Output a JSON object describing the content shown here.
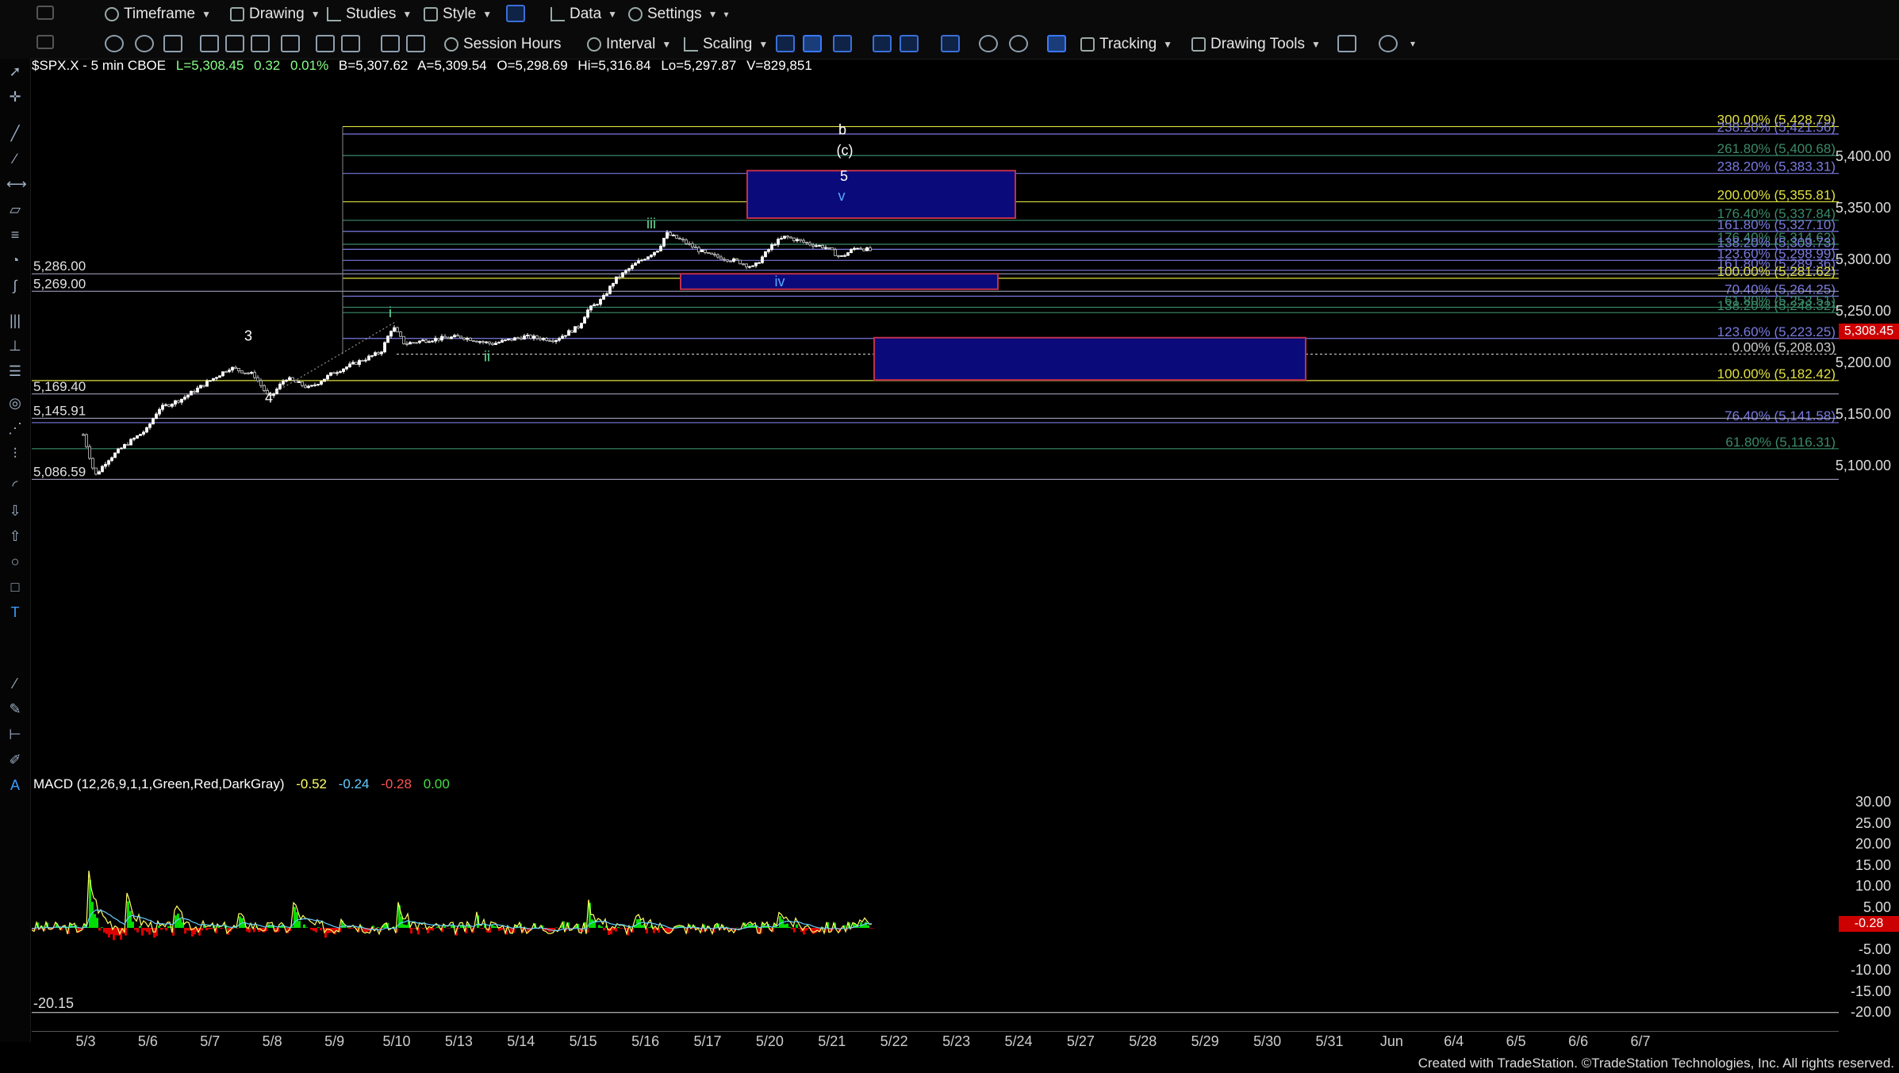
{
  "toolbar1": {
    "timeframe": "Timeframe",
    "drawing": "Drawing",
    "studies": "Studies",
    "style": "Style",
    "data": "Data",
    "settings": "Settings"
  },
  "toolbar2": {
    "session_hours": "Session Hours",
    "interval": "Interval",
    "scaling": "Scaling",
    "tracking": "Tracking",
    "drawing_tools": "Drawing Tools"
  },
  "status": {
    "symbol": "$SPX.X - 5 min  CBOE",
    "last": "L=5,308.45",
    "change": "0.32",
    "pct": "0.01%",
    "bid": "B=5,307.62",
    "ask": "A=5,309.54",
    "open": "O=5,298.69",
    "high": "Hi=5,316.84",
    "low": "Lo=5,297.87",
    "volume": "V=829,851"
  },
  "price_tag": "5,308.45",
  "macd_tag": "-0.28",
  "macd": {
    "name": "MACD (12,26,9,1,1,Green,Red,DarkGray)",
    "v1": "-0.52",
    "v2": "-0.24",
    "v3": "-0.28",
    "v4": "0.00",
    "low_label": "-20.15"
  },
  "colors": {
    "up_candle": "#ffffff",
    "down_candle": "#c8c8c8",
    "box_fill": "#0a0a7a",
    "box_border": "#c0304a",
    "fib_purple": "#7a7ae0",
    "fib_green": "#3a8a6a",
    "fib_yellow": "#e0e040",
    "macd_up": "#00dd00",
    "macd_down": "#dd0000"
  },
  "chart_data": {
    "type": "candlestick",
    "price_axis": [
      "5,400.00",
      "5,350.00",
      "5,300.00",
      "5,250.00",
      "5,200.00",
      "5,150.00",
      "5,100.00"
    ],
    "macd_axis": [
      "30.00",
      "25.00",
      "20.00",
      "15.00",
      "10.00",
      "5.00",
      "-5.00",
      "-10.00",
      "-15.00",
      "-20.00"
    ],
    "x_ticks": [
      "5/3",
      "5/6",
      "5/7",
      "5/8",
      "5/9",
      "5/10",
      "5/13",
      "5/14",
      "5/15",
      "5/16",
      "5/17",
      "5/20",
      "5/21",
      "5/22",
      "5/23",
      "5/24",
      "5/27",
      "5/28",
      "5/29",
      "5/30",
      "5/31",
      "Jun",
      "6/4",
      "6/5",
      "6/6",
      "6/7"
    ],
    "fib_levels": [
      {
        "label": "300.00% (5,428.79)",
        "value": 5428.79,
        "color": "yellow"
      },
      {
        "label": "238.20% (5,421.56)",
        "value": 5421.56,
        "color": "purple"
      },
      {
        "label": "261.80% (5,400.68)",
        "value": 5400.68,
        "color": "green"
      },
      {
        "label": "238.20% (5,383.31)",
        "value": 5383.31,
        "color": "purple"
      },
      {
        "label": "200.00% (5,355.81)",
        "value": 5355.81,
        "color": "yellow"
      },
      {
        "label": "176.40% (5,337.84)",
        "value": 5337.84,
        "color": "green"
      },
      {
        "label": "161.80% (5,327.10)",
        "value": 5327.1,
        "color": "purple"
      },
      {
        "label": "176.40% (5,314.62)",
        "value": 5314.62,
        "color": "green"
      },
      {
        "label": "138.20% (5,309.73)",
        "value": 5309.73,
        "color": "purple"
      },
      {
        "label": "123.60% (5,298.99)",
        "value": 5298.99,
        "color": "purple"
      },
      {
        "label": "161.80% (5,289.36)",
        "value": 5289.36,
        "color": "purple"
      },
      {
        "label": "100.00% (5,281.62)",
        "value": 5281.62,
        "color": "yellow"
      },
      {
        "label": "70.40% (5,264.25)",
        "value": 5264.25,
        "color": "purple"
      },
      {
        "label": "61.80% (5,253.51)",
        "value": 5253.51,
        "color": "green"
      },
      {
        "label": "138.20% (5,248.32)",
        "value": 5248.32,
        "color": "green"
      },
      {
        "label": "123.60% (5,223.25)",
        "value": 5223.25,
        "color": "purple"
      },
      {
        "label": "0.00% (5,208.03)",
        "value": 5208.03,
        "color": "white"
      },
      {
        "label": "100.00% (5,182.42)",
        "value": 5182.42,
        "color": "yellow"
      },
      {
        "label": "76.40% (5,141.58)",
        "value": 5141.58,
        "color": "purple"
      },
      {
        "label": "61.80% (5,116.31)",
        "value": 5116.31,
        "color": "green"
      }
    ],
    "horizontal_levels": [
      {
        "label": "5,286.00",
        "value": 5286.0
      },
      {
        "label": "5,269.00",
        "value": 5269.0
      },
      {
        "label": "5,169.40",
        "value": 5169.4
      },
      {
        "label": "5,145.91",
        "value": 5145.91
      },
      {
        "label": "5,086.59",
        "value": 5086.59
      }
    ],
    "wave_labels": [
      {
        "text": "b",
        "color": "white"
      },
      {
        "text": "(c)",
        "color": "white"
      },
      {
        "text": "5",
        "color": "white"
      },
      {
        "text": "v",
        "color": "blue"
      },
      {
        "text": "iii",
        "color": "green"
      },
      {
        "text": "iv",
        "color": "blue"
      },
      {
        "text": "i",
        "color": "green"
      },
      {
        "text": "ii",
        "color": "green"
      },
      {
        "text": "3",
        "color": "white"
      },
      {
        "text": "4",
        "color": "white"
      }
    ]
  },
  "footer": "Created with TradeStation. ©TradeStation Technologies, Inc. All rights reserved."
}
